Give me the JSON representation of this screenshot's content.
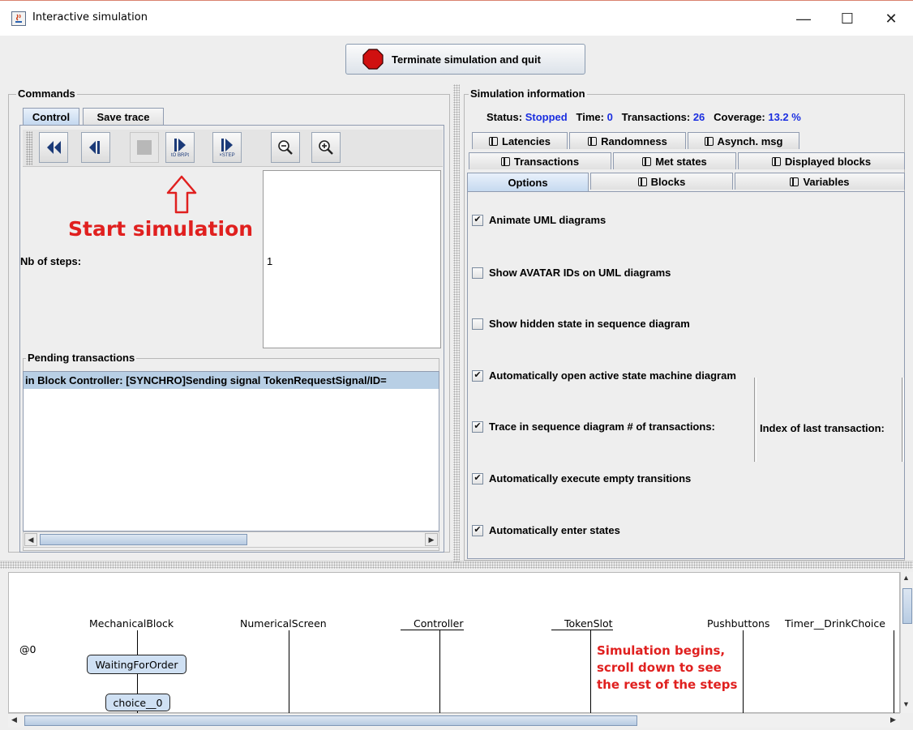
{
  "window": {
    "title": "Interactive simulation",
    "controls": {
      "minimize": "—",
      "maximize": "☐",
      "close": "✕"
    }
  },
  "terminate_button": {
    "label": "Terminate simulation and quit",
    "icon": "stop-sign-icon",
    "icon_color": "#d01010"
  },
  "commands": {
    "title": "Commands",
    "tabs": [
      {
        "label": "Control",
        "selected": true
      },
      {
        "label": "Save trace",
        "selected": false
      }
    ],
    "toolbar": [
      {
        "name": "rewind-button",
        "icon": "double-back-icon"
      },
      {
        "name": "back-step-button",
        "icon": "step-back-icon"
      },
      {
        "name": "stop-button",
        "icon": "stop-square-icon",
        "disabled": true
      },
      {
        "name": "run-to-breakpoint-button",
        "icon": "run-breakpoint-icon",
        "sublabel": "tO BRPt"
      },
      {
        "name": "run-x-steps-button",
        "icon": "run-steps-icon",
        "sublabel": "×STEP"
      },
      {
        "name": "zoom-out-button",
        "icon": "zoom-out-icon"
      },
      {
        "name": "zoom-in-button",
        "icon": "zoom-in-icon"
      }
    ],
    "annotation": "Start simulation",
    "annotation_color": "#e0201f",
    "steps_label": "Nb of steps:",
    "steps_value": "1",
    "pending": {
      "title": "Pending transactions",
      "items": [
        "in Block Controller: [SYNCHRO]Sending signal TokenRequestSignal/ID="
      ]
    }
  },
  "info": {
    "title": "Simulation information",
    "status_label": "Status:",
    "status_value": "Stopped",
    "time_label": "Time:",
    "time_value": "0",
    "transactions_label": "Transactions:",
    "transactions_value": "26",
    "coverage_label": "Coverage:",
    "coverage_value": "13.2 %",
    "tabs_row1": [
      "Latencies",
      "Randomness",
      "Asynch. msg"
    ],
    "tabs_row2": [
      "Transactions",
      "Met states",
      "Displayed blocks"
    ],
    "tabs_row3": [
      "Options",
      "Blocks",
      "Variables"
    ],
    "options": [
      {
        "label": "Animate UML diagrams",
        "checked": true
      },
      {
        "label": "Show AVATAR IDs on UML diagrams",
        "checked": false
      },
      {
        "label": "Show hidden state in sequence diagram",
        "checked": false
      },
      {
        "label": "Automatically open active state machine diagram",
        "checked": true
      },
      {
        "label": "Trace in sequence diagram # of transactions:",
        "checked": true,
        "extra": "Index of last transaction:"
      },
      {
        "label": "Automatically execute empty transitions",
        "checked": true
      },
      {
        "label": "Automatically enter states",
        "checked": true
      }
    ]
  },
  "sequence": {
    "time_marker": "@0",
    "lifelines": [
      "MechanicalBlock",
      "NumericalScreen",
      "Controller",
      "TokenSlot",
      "Pushbuttons",
      "Timer__DrinkChoice"
    ],
    "states": [
      "WaitingForOrder",
      "choice__0"
    ],
    "annotation": [
      "Simulation begins,",
      "scroll down to see",
      "the rest of the steps"
    ],
    "annotation_color": "#e0201f"
  }
}
